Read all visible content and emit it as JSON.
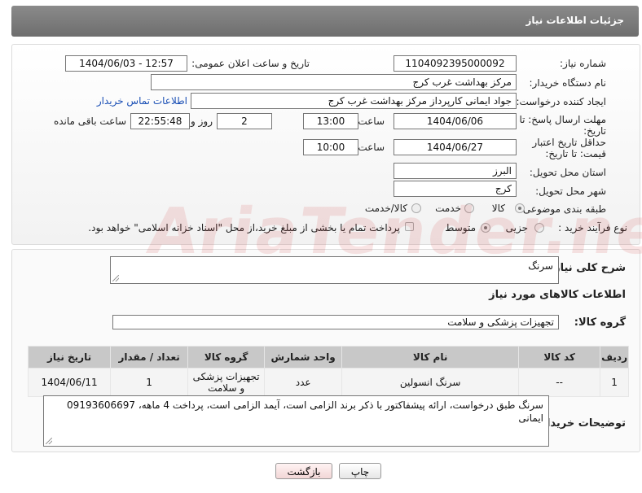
{
  "header": {
    "title": "جزئیات اطلاعات نیاز"
  },
  "fields": {
    "need_number_label": "شماره نیاز:",
    "need_number": "1104092395000092",
    "announce_label": "تاریخ و ساعت اعلان عمومی:",
    "announce_value": "1404/06/03 - 12:57",
    "buyer_org_label": "نام دستگاه خریدار:",
    "buyer_org": "مرکز بهداشت غرب کرج",
    "creator_label": "ایجاد کننده درخواست:",
    "creator": "جواد ایمانی کارپرداز مرکز بهداشت غرب کرج",
    "contact_link": "اطلاعات تماس خریدار",
    "deadline_label": "مهلت ارسال پاسخ: تا تاریخ:",
    "deadline_date": "1404/06/06",
    "time_label": "ساعت",
    "deadline_time": "13:00",
    "days_value": "2",
    "days_label": "روز و",
    "remaining_time": "22:55:48",
    "remaining_label": "ساعت باقی مانده",
    "validity_label": "حداقل تاریخ اعتبار قیمت: تا تاریخ:",
    "validity_date": "1404/06/27",
    "validity_time": "10:00",
    "province_label": "استان محل تحویل:",
    "province": "البرز",
    "city_label": "شهر محل تحویل:",
    "city": "کرج",
    "category_label": "طبقه بندی موضوعی:",
    "category_options": [
      "کالا",
      "خدمت",
      "کالا/خدمت"
    ],
    "process_label": "نوع فرآیند خرید :",
    "process_options": [
      "جزیی",
      "متوسط"
    ],
    "payment_note": "پرداخت تمام یا بخشی از مبلغ خرید،از محل \"اسناد خزانه اسلامی\" خواهد بود."
  },
  "details": {
    "summary_label": "شرح کلی نیاز:",
    "summary": "سرنگ",
    "goods_info_title": "اطلاعات کالاهای مورد نیاز",
    "goods_group_label": "گروه کالا:",
    "goods_group": "تجهیزات پزشکی و سلامت"
  },
  "table": {
    "headers": [
      "ردیف",
      "کد کالا",
      "نام کالا",
      "واحد شمارش",
      "گروه کالا",
      "تعداد / مقدار",
      "تاریخ نیاز"
    ],
    "rows": [
      [
        "1",
        "--",
        "سرنگ انسولین",
        "عدد",
        "تجهیزات پزشکی و سلامت",
        "1",
        "1404/06/11"
      ]
    ]
  },
  "buyer_notes": {
    "label": "توضیحات خریدار:",
    "text": "سرنگ طبق درخواست، ارائه پیشفاکتور با ذکر برند الزامی است، آیمد الزامی است، پرداخت 4 ماهه، 09193606697 ایمانی"
  },
  "buttons": {
    "print": "چاپ",
    "back": "بازگشت"
  },
  "watermark": "AriaTender.neT"
}
